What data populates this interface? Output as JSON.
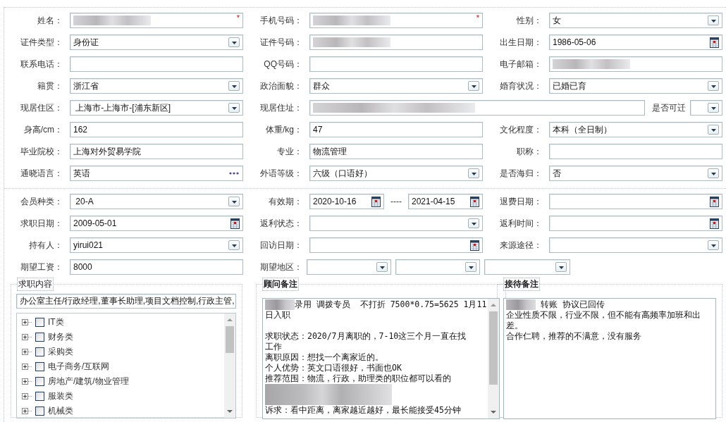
{
  "sections": [
    {
      "rows": [
        [
          {
            "label": "姓名：",
            "kind": "text",
            "redacted": true,
            "required_mark": "*"
          },
          {
            "label": "手机号码：",
            "kind": "text",
            "redacted": true,
            "required_mark": "*"
          },
          {
            "label": "性别：",
            "kind": "select",
            "value": "女",
            "redacted": false
          }
        ],
        [
          {
            "label": "证件类型：",
            "kind": "select",
            "value": "身份证",
            "redacted": false
          },
          {
            "label": "证件号码：",
            "kind": "text",
            "redacted": true
          },
          {
            "label": "出生日期：",
            "kind": "date",
            "value": "1986-05-06",
            "redacted": false
          }
        ],
        [
          {
            "label": "联系电话：",
            "kind": "text",
            "redacted": false
          },
          {
            "label": "QQ号码：",
            "kind": "text",
            "redacted": false
          },
          {
            "label": "电子邮箱：",
            "kind": "text",
            "redacted": true
          }
        ],
        [
          {
            "label": "籍贯：",
            "kind": "select",
            "value": "浙江省",
            "redacted": false
          },
          {
            "label": "政治面貌：",
            "kind": "select",
            "value": "群众",
            "redacted": false
          },
          {
            "label": "婚育状况：",
            "kind": "select",
            "value": "已婚已育",
            "redacted": false
          }
        ],
        [
          {
            "label": "现居住区：",
            "kind": "select",
            "value": " 上海市-上海市-[浦东新区]",
            "redacted": false
          },
          {
            "label": "现居住址：",
            "kind": "wide_text",
            "redacted": true,
            "extra": {
              "label": "是否可迁",
              "kind": "select",
              "redacted": false
            }
          }
        ],
        [
          {
            "label": "身高/cm：",
            "kind": "text",
            "value": "162",
            "redacted": false
          },
          {
            "label": "体重/kg：",
            "kind": "text",
            "value": "47",
            "redacted": false
          },
          {
            "label": "文化程度：",
            "kind": "select",
            "value": "本科（全日制）",
            "redacted": false
          }
        ],
        [
          {
            "label": "毕业院校：",
            "kind": "text",
            "value": "上海对外贸易学院",
            "redacted": false
          },
          {
            "label": "专业：",
            "kind": "text",
            "value": "物流管理",
            "redacted": false
          },
          {
            "label": "职称：",
            "kind": "text",
            "redacted": false
          }
        ],
        [
          {
            "label": "通晓语言：",
            "kind": "lookup",
            "value": "英语",
            "redacted": false
          },
          {
            "label": "外语等级：",
            "kind": "select",
            "value": "六级（口语好）",
            "redacted": false
          },
          {
            "label": "是否海归：",
            "kind": "select",
            "value": "否",
            "redacted": false
          }
        ]
      ]
    },
    {
      "rows": [
        [
          {
            "label": "会员种类：",
            "kind": "select",
            "value": " 20-A",
            "redacted": false
          },
          {
            "label": "有效期：",
            "kind": "date_range",
            "from": "2020-10-16",
            "separator": "----",
            "to": "2021-04-15",
            "redacted": false
          },
          {
            "label": "退费日期：",
            "kind": "date",
            "redacted": false
          }
        ],
        [
          {
            "label": "求职日期：",
            "kind": "date",
            "value": "2009-05-01",
            "redacted": false
          },
          {
            "label": "返利状态：",
            "kind": "select",
            "redacted": false
          },
          {
            "label": "返利时间：",
            "kind": "date",
            "redacted": false
          }
        ],
        [
          {
            "label": "持有人：",
            "kind": "select",
            "value": "yirui021",
            "redacted": false
          },
          {
            "label": "回访日期：",
            "kind": "date",
            "redacted": false
          },
          {
            "label": "来源途径：",
            "kind": "select",
            "redacted": false
          }
        ],
        [
          {
            "label": "期望工资：",
            "kind": "text",
            "value": "8000",
            "redacted": false
          },
          {
            "label": "期望地区：",
            "kind": "multi_select",
            "selects": [
              {
                "kind": "select"
              },
              {
                "kind": "select"
              },
              {
                "kind": "select"
              }
            ],
            "redacted": false
          }
        ]
      ]
    }
  ],
  "job_content": {
    "legend": "求职内容",
    "value": "办公室主任/行政经理,董事长助理,项目文档控制,行政主管,",
    "tree": [
      {
        "label": "IT类",
        "checked": false,
        "expanded": false
      },
      {
        "label": "财务类",
        "checked": false,
        "expanded": false
      },
      {
        "label": "采购类",
        "checked": false,
        "expanded": false
      },
      {
        "label": "电子商务/互联网",
        "checked": false,
        "expanded": false
      },
      {
        "label": "房地产/建筑/物业管理",
        "checked": false,
        "expanded": false
      },
      {
        "label": "服装类",
        "checked": false,
        "expanded": false
      },
      {
        "label": "机械类",
        "checked": false,
        "expanded": false
      }
    ]
  },
  "notes": [
    {
      "legend": "顾问备注",
      "bold": true,
      "scrollbar": true,
      "lines": [
        {
          "kind": "text",
          "redacted_prefix": true,
          "text": "录用 调拨专员  不打折 7500*0.75=5625 1月11"
        },
        {
          "kind": "text",
          "redacted_prefix": false,
          "text": "日入职"
        },
        {
          "kind": "blank"
        },
        {
          "kind": "text",
          "redacted_prefix": false,
          "text": "求职状态：2020/7月离职的，7-10这三个月一直在找"
        },
        {
          "kind": "text",
          "redacted_prefix": false,
          "text": "工作"
        },
        {
          "kind": "text",
          "redacted_prefix": false,
          "text": "离职原因：想找一个离家近的。"
        },
        {
          "kind": "text",
          "redacted_prefix": false,
          "text": "个人优势：英文口语很好，书面也OK"
        },
        {
          "kind": "text",
          "redacted_prefix": false,
          "text": "推荐范围：物流，行政，助理类的职位都可以看的"
        },
        {
          "kind": "redacted"
        },
        {
          "kind": "text",
          "redacted_prefix": false,
          "text": "诉求：看中距离，离家越近越好，最长能接受45分钟"
        }
      ]
    },
    {
      "legend": "接待备注",
      "bold": true,
      "scrollbar": false,
      "lines": [
        {
          "kind": "text",
          "redacted_prefix": true,
          "text": " 转账 协议已回传"
        },
        {
          "kind": "text",
          "redacted_prefix": false,
          "text": "企业性质不限，行业不限，但不能有高频率加班和出"
        },
        {
          "kind": "text",
          "redacted_prefix": false,
          "text": "差。"
        },
        {
          "kind": "text",
          "redacted_prefix": false,
          "text": "合作仁聘，推荐的不满意，没有服务"
        }
      ]
    }
  ]
}
